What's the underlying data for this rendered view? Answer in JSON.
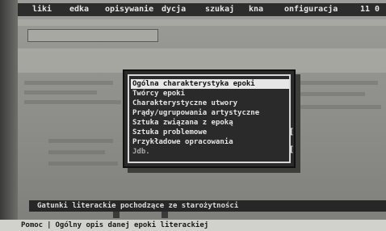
{
  "menubar": {
    "items": [
      "liki",
      "edka",
      "opisywanie",
      "dycja",
      "szukaj",
      "kna",
      "onfiguracja",
      "11 0"
    ]
  },
  "dialog": {
    "items": [
      {
        "label": "Ogólna charakterystyka epoki",
        "selected": true
      },
      {
        "label": "Twórcy epoki",
        "selected": false
      },
      {
        "label": "Charakterystyczne utwory",
        "selected": false
      },
      {
        "label": "Prądy/ugrupowania artystyczne",
        "selected": false
      },
      {
        "label": "Sztuka związana z epoką",
        "selected": false
      },
      {
        "label": "Sztuka problemowe",
        "selected": false
      },
      {
        "label": "Przykładowe opracowania",
        "selected": false
      },
      {
        "label": "Jdb.",
        "selected": false
      }
    ]
  },
  "status": {
    "text": "Gatunki literackie pochodzące ze starożytności"
  },
  "helpbar": {
    "key": "Pomoc",
    "separator": "|",
    "description": "Ogólny opis danej epoki literackiej"
  },
  "colors": {
    "screen_bg": "#8f8f8b",
    "menubar_bg": "#2c2c2c",
    "dialog_bg": "#2a2a2a",
    "highlight": "#e6e6e6"
  }
}
